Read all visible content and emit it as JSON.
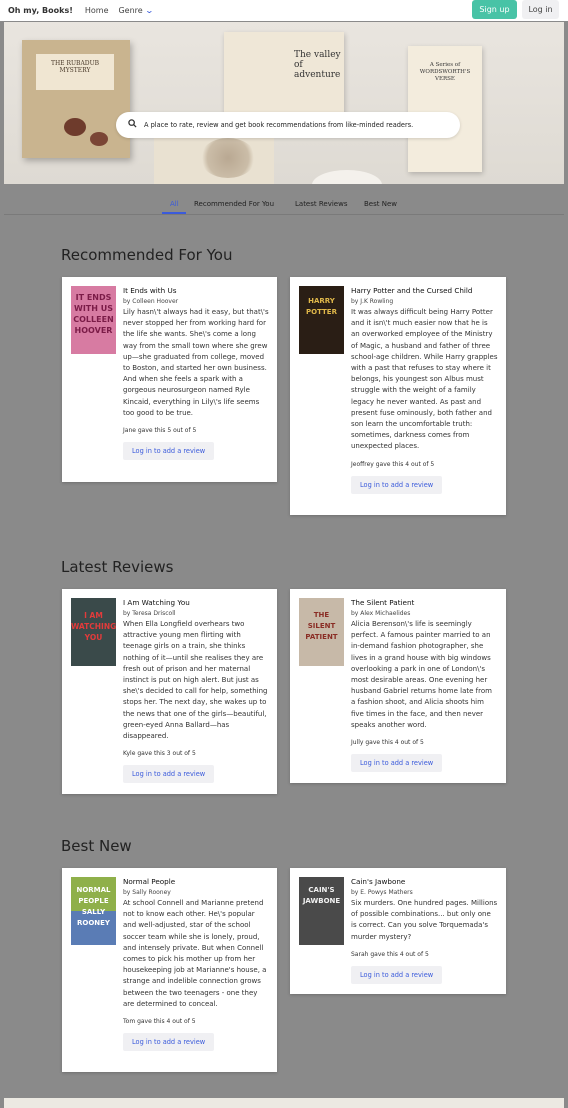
{
  "nav": {
    "brand": "Oh my, Books!",
    "home": "Home",
    "genre": "Genre",
    "signup": "Sign up",
    "login": "Log in"
  },
  "hero": {
    "search_text": "A place to rate, review and get book recommendations from like-minded readers.",
    "book1_title": "THE RUBADUB MYSTERY",
    "book2_title": "The valley of adventure",
    "book3_title": "A Series of WORDSWORTH'S VERSE"
  },
  "tabs": [
    "All",
    "Recommended For You",
    "Latest Reviews",
    "Best New"
  ],
  "sections": [
    {
      "title": "Recommended For You",
      "cards": [
        {
          "title": "It Ends with Us",
          "author": "by Colleen Hoover",
          "desc": "Lily hasn\\'t always had it easy, but that\\'s never stopped her from working hard for the life she wants. She\\'s come a long way from the small town where she grew up—she graduated from college, moved to Boston, and started her own business. And when she feels a spark with a gorgeous neurosurgeon named Ryle Kincaid, everything in Lily\\'s life seems too good to be true.",
          "gave": "Jane gave this 5 out of 5",
          "review_btn": "Log in to add a review",
          "cover_text": "IT ENDS WITH US COLLEEN HOOVER"
        },
        {
          "title": "Harry Potter and the Cursed Child",
          "author": "by J.K Rowling",
          "desc": "It was always difficult being Harry Potter and it isn\\'t much easier now that he is an overworked employee of the Ministry of Magic, a husband and father of three school-age children. While Harry grapples with a past that refuses to stay where it belongs, his youngest son Albus must struggle with the weight of a family legacy he never wanted. As past and present fuse ominously, both father and son learn the uncomfortable truth: sometimes, darkness comes from unexpected places.",
          "gave": "Jeoffrey gave this 4 out of 5",
          "review_btn": "Log in to add a review",
          "cover_text": "HARRY POTTER"
        }
      ]
    },
    {
      "title": "Latest Reviews",
      "cards": [
        {
          "title": "I Am Watching You",
          "author": "by Teresa Driscoll",
          "desc": "When Ella Longfield overhears two attractive young men flirting with teenage girls on a train, she thinks nothing of it—until she realises they are fresh out of prison and her maternal instinct is put on high alert. But just as she\\'s decided to call for help, something stops her. The next day, she wakes up to the news that one of the girls—beautiful, green-eyed Anna Ballard—has disappeared.",
          "gave": "Kyle gave this 3 out of 5",
          "review_btn": "Log in to add a review",
          "cover_text": "I AM WATCHING YOU"
        },
        {
          "title": "The Silent Patient",
          "author": "by Alex Michaelides",
          "desc": "Alicia Berenson\\'s life is seemingly perfect. A famous painter married to an in-demand fashion photographer, she lives in a grand house with big windows overlooking a park in one of London\\'s most desirable areas. One evening her husband Gabriel returns home late from a fashion shoot, and Alicia shoots him five times in the face, and then never speaks another word.",
          "gave": "Jully gave this 4 out of 5",
          "review_btn": "Log in to add a review",
          "cover_text": "THE SILENT PATIENT"
        }
      ]
    },
    {
      "title": "Best New",
      "cards": [
        {
          "title": "Normal People",
          "author": "by Sally Rooney",
          "desc": "At school Connell and Marianne pretend not to know each other. He\\'s popular and well-adjusted, star of the school soccer team while she is lonely, proud, and intensely private. But when Connell comes to pick his mother up from her housekeeping job at Marianne's house, a strange and indelible connection grows between the two teenagers - one they are determined to conceal.",
          "gave": "Tom gave this 4 out of 5",
          "review_btn": "Log in to add a review",
          "cover_text": "NORMAL PEOPLE SALLY ROONEY"
        },
        {
          "title": "Cain's Jawbone",
          "author": "by E. Powys Mathers",
          "desc": "Six murders. One hundred pages. Millions of possible combinations... but only one is correct. Can you solve Torquemada's murder mystery?",
          "gave": "Sarah gave this 4 out of 5",
          "review_btn": "Log in to add a review",
          "cover_text": "CAIN'S JAWBONE"
        }
      ]
    }
  ],
  "colors": {
    "accent": "#3b5bdb",
    "signup": "#48c3a6",
    "page_bg": "#8a8a8a"
  },
  "icons": {
    "search": "magnifier-icon",
    "genre_dropdown": "chevron-down-icon"
  }
}
